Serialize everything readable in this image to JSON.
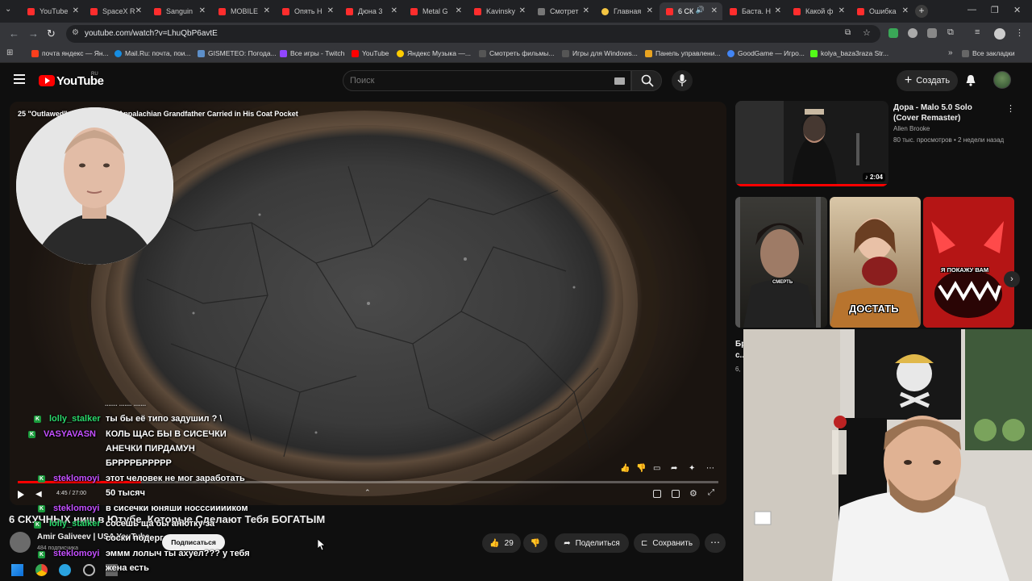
{
  "browser": {
    "tabs": [
      {
        "title": "YouTube",
        "active": false
      },
      {
        "title": "SpaceX R",
        "active": false
      },
      {
        "title": "Sanguin",
        "active": false
      },
      {
        "title": "MOBILE",
        "active": false
      },
      {
        "title": "Опять Н",
        "active": false
      },
      {
        "title": "Дюна 3",
        "active": false
      },
      {
        "title": "Metal G",
        "active": false
      },
      {
        "title": "Kavinsky",
        "active": false
      },
      {
        "title": "Смотрет",
        "active": false
      },
      {
        "title": "Главная",
        "active": false
      },
      {
        "title": "6 СК",
        "active": true
      },
      {
        "title": "Баста. Н",
        "active": false
      },
      {
        "title": "Какой ф",
        "active": false
      },
      {
        "title": "Ошибка",
        "active": false
      }
    ],
    "url": "youtube.com/watch?v=LhuQbP6avtE",
    "bookmarks": [
      "почта яндекс — Ян...",
      "Mail.Ru: почта, пои...",
      "GISMETEO: Погода...",
      "Все игры - Twitch",
      "YouTube",
      "Яндекс Музыка —...",
      "Смотреть фильмы...",
      "Игры для Windows...",
      "Панель управлени...",
      "GoodGame — Игро...",
      "kolya_baza3raza Str..."
    ],
    "all_bookmarks_label": "Все закладки"
  },
  "youtube": {
    "logo_text": "YouTube",
    "logo_region": "RU",
    "search_placeholder": "Поиск",
    "create_label": "Создать",
    "player": {
      "overlay_title": "25 \"Outlawed\" ... pons Every Appalachian Grandfather Carried in His Coat Pocket",
      "time": "4:45 / 27:00",
      "progress": 0.176
    },
    "video": {
      "title": "6 СКУЧНЫХ ниш в Ютубе, Которые Сделают Тебя БОГАТЫМ",
      "channel": "Amir Galiveev | USA YouTube",
      "subscribers": "484 подписчика",
      "subscribe_label": "Подписаться",
      "likes": "29",
      "share_label": "Поделиться",
      "save_label": "Сохранить"
    },
    "recommendation": {
      "title": "Дора - Malo 5.0 Solo (Cover Remaster)",
      "channel": "Allen Brooke",
      "meta": "80 тыс. просмотров • 2 недели назад",
      "duration": "2:04"
    },
    "shorts": [
      {
        "label": "СМЕРТЬ"
      },
      {
        "label": "ДОСТАТЬ"
      },
      {
        "label": "Я ПОКАЖУ ВАМ"
      }
    ],
    "sidebar_partial": [
      "Бр",
      "с...",
      "6,"
    ]
  },
  "chat": [
    {
      "user": "",
      "text": "....... ....... .......",
      "color": "#ffffff"
    },
    {
      "user": "lolly_stalker",
      "text": "ты бы её типо задушил ? \\",
      "color": "#2ad86b"
    },
    {
      "user": "VASYAVASN",
      "text": "КОЛЬ ЩАС БЫ В СИСЕЧКИ",
      "color": "#c44fff"
    },
    {
      "user": "",
      "text": "АНЕЧКИ ПИРДАМУН",
      "color": "#ffffff"
    },
    {
      "user": "",
      "text": "БРРРРБРРРРР",
      "color": "#ffffff"
    },
    {
      "user": "steklomoyi",
      "text": "этот человек не мог заработать",
      "color": "#c44fff"
    },
    {
      "user": "",
      "text": "50 тысяч",
      "color": "#ffffff"
    },
    {
      "user": "steklomoyi",
      "text": "в сисечки юняши носссииииком",
      "color": "#c44fff"
    },
    {
      "user": "lolly_stalker",
      "text": "сосешь ща бы анютку за",
      "color": "#2ad86b"
    },
    {
      "user": "",
      "text": "соски подергать",
      "color": "#ffffff"
    },
    {
      "user": "steklomoyi",
      "text": "эммм лолыч ты ахуел??? у тебя",
      "color": "#c44fff"
    },
    {
      "user": "",
      "text": "жена есть",
      "color": "#ffffff"
    }
  ]
}
